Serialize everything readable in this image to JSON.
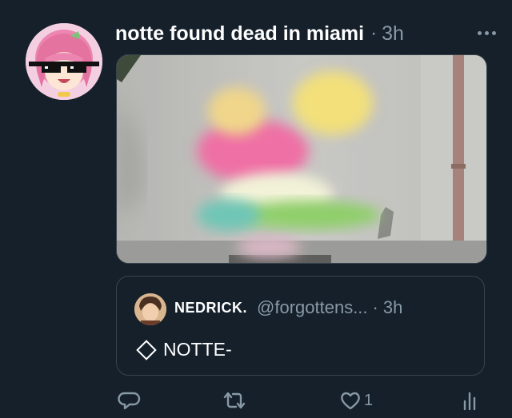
{
  "tweet": {
    "display_name": "notte found dead in miami",
    "separator": "·",
    "time": "3h"
  },
  "quoted_tweet": {
    "display_name": "NEDRICK.",
    "handle": "@forgottens...",
    "separator": "·",
    "time": "3h",
    "text": "NOTTE-"
  },
  "actions": {
    "reply_count": "",
    "retweet_count": "",
    "like_count": "1"
  },
  "icons": [
    "avatar",
    "more-icon",
    "reply-icon",
    "retweet-icon",
    "like-icon",
    "share-icon",
    "diamond-icon"
  ],
  "colors": {
    "background": "#15202b",
    "secondary_text": "#8899a6",
    "border": "#38444d"
  }
}
